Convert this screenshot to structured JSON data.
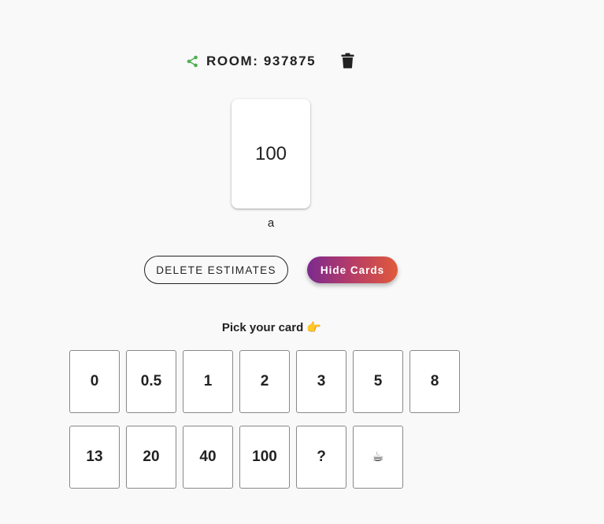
{
  "header": {
    "room_title": "ROOM: 937875",
    "share_icon": "share-icon",
    "delete_room_icon": "trash-icon",
    "accent": "#4caf50"
  },
  "revealed": {
    "card_value": "100",
    "user_name": "a"
  },
  "actions": {
    "delete_estimates_label": "DELETE ESTIMATES",
    "hide_cards_label": "Hide Cards"
  },
  "picker": {
    "label": "Pick your card 👉",
    "row1": [
      "0",
      "0.5",
      "1",
      "2",
      "3",
      "5",
      "8"
    ],
    "row2": [
      "13",
      "20",
      "40",
      "100",
      "?",
      "☕"
    ]
  }
}
